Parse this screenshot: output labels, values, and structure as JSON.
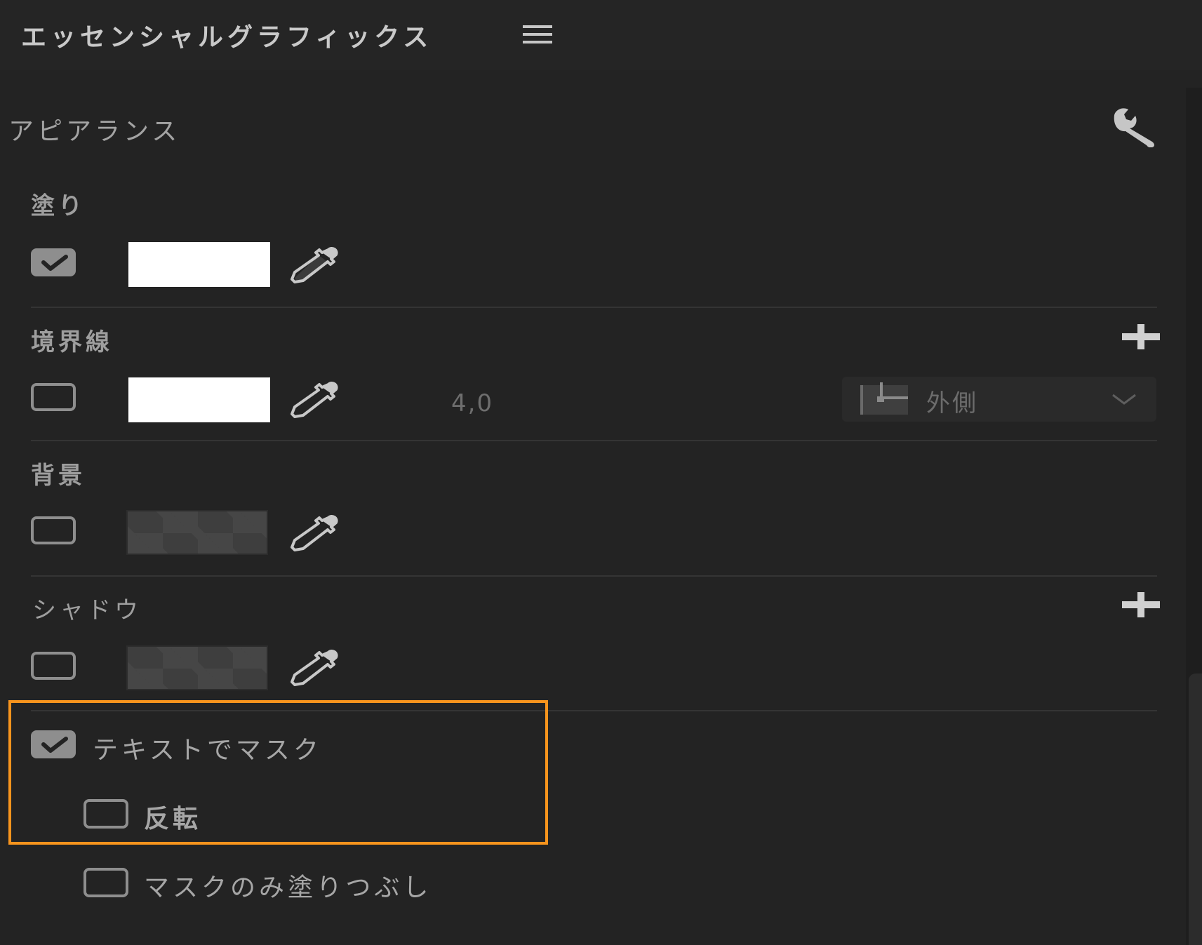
{
  "panel": {
    "title": "エッセンシャルグラフィックス"
  },
  "appearance": {
    "title": "アピアランス"
  },
  "fill": {
    "label": "塗り",
    "enabled": true,
    "color": "#ffffff"
  },
  "stroke": {
    "label": "境界線",
    "enabled": false,
    "color": "#ffffff",
    "width": "4,0",
    "position": "外側"
  },
  "background": {
    "label": "背景",
    "enabled": false
  },
  "shadow": {
    "label": "シャドウ",
    "enabled": false
  },
  "mask": {
    "mask_with_text_label": "テキストでマスク",
    "mask_with_text_checked": true,
    "invert_label": "反転",
    "invert_checked": false,
    "fill_mask_only_label": "マスクのみ塗りつぶし",
    "fill_mask_only_checked": false
  },
  "colors": {
    "background": "#232323",
    "highlight": "#f7941d",
    "checkbox": "#8e8e8e"
  },
  "icons": {
    "menu": "hamburger-menu-icon",
    "settings": "wrench-icon",
    "eyedropper": "eyedropper-icon",
    "add": "plus-icon",
    "stroke_position": "stroke-position-icon",
    "dropdown": "chevron-down-icon"
  }
}
